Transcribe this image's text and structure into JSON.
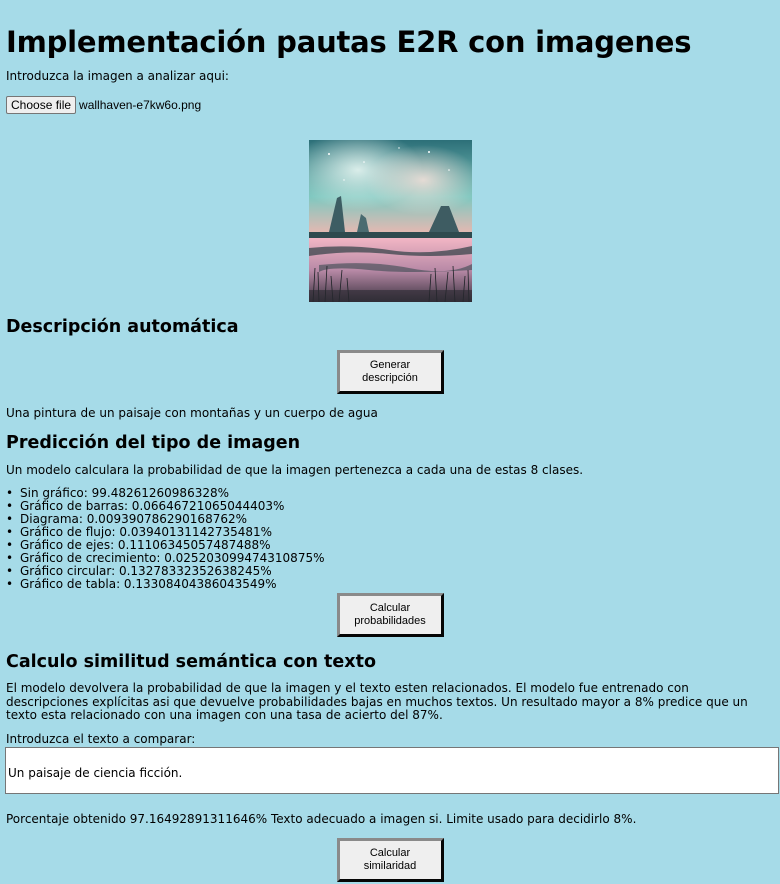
{
  "title": "Implementación pautas E2R con imagenes",
  "upload": {
    "prompt": "Introduzca la imagen a analizar aqui:",
    "button_label": "Choose file",
    "file_name": "wallhaven-e7kw6o.png"
  },
  "description_section": {
    "heading": "Descripción automática",
    "button_label": "Generar descripción",
    "result": "Una pintura de un paisaje con montañas y un cuerpo de agua"
  },
  "prediction_section": {
    "heading": "Predicción del tipo de imagen",
    "intro": "Un modelo calculara la probabilidad de que la imagen pertenezca a cada una de estas 8 clases.",
    "items": [
      "Sin gráfico: 99.48261260986328%",
      "Gráfico de barras: 0.06646721065044403%",
      "Diagrama: 0.009390786290168762%",
      "Gráfico de flujo: 0.03940131142735481%",
      "Gráfico de ejes: 0.11106345057487488%",
      "Gráfico de crecimiento: 0.025203099474310875%",
      "Gráfico circular: 0.13278332352638245%",
      "Gráfico de tabla: 0.13308404386043549%"
    ],
    "button_label": "Calcular probabilidades"
  },
  "similarity_section": {
    "heading": "Calculo similitud semántica con texto",
    "intro": "El modelo devolvera la probabilidad de que la imagen y el texto esten relacionados. El modelo fue entrenado con descripciones explícitas asi que devuelve probabilidades bajas en muchos textos. Un resultado mayor a 8% predice que un texto esta relacionado con una imagen con una tasa de acierto del 87%.",
    "input_label": "Introduzca el texto a comparar:",
    "input_value": "Un paisaje de ciencia ficción.",
    "result": "Porcentaje obtenido 97.16492891311646% Texto adecuado a imagen si. Limite usado para decidirlo 8%.",
    "button_label": "Calcular similaridad"
  },
  "colors": {
    "background": "#a6dbe8",
    "button_bg": "#efefef"
  }
}
